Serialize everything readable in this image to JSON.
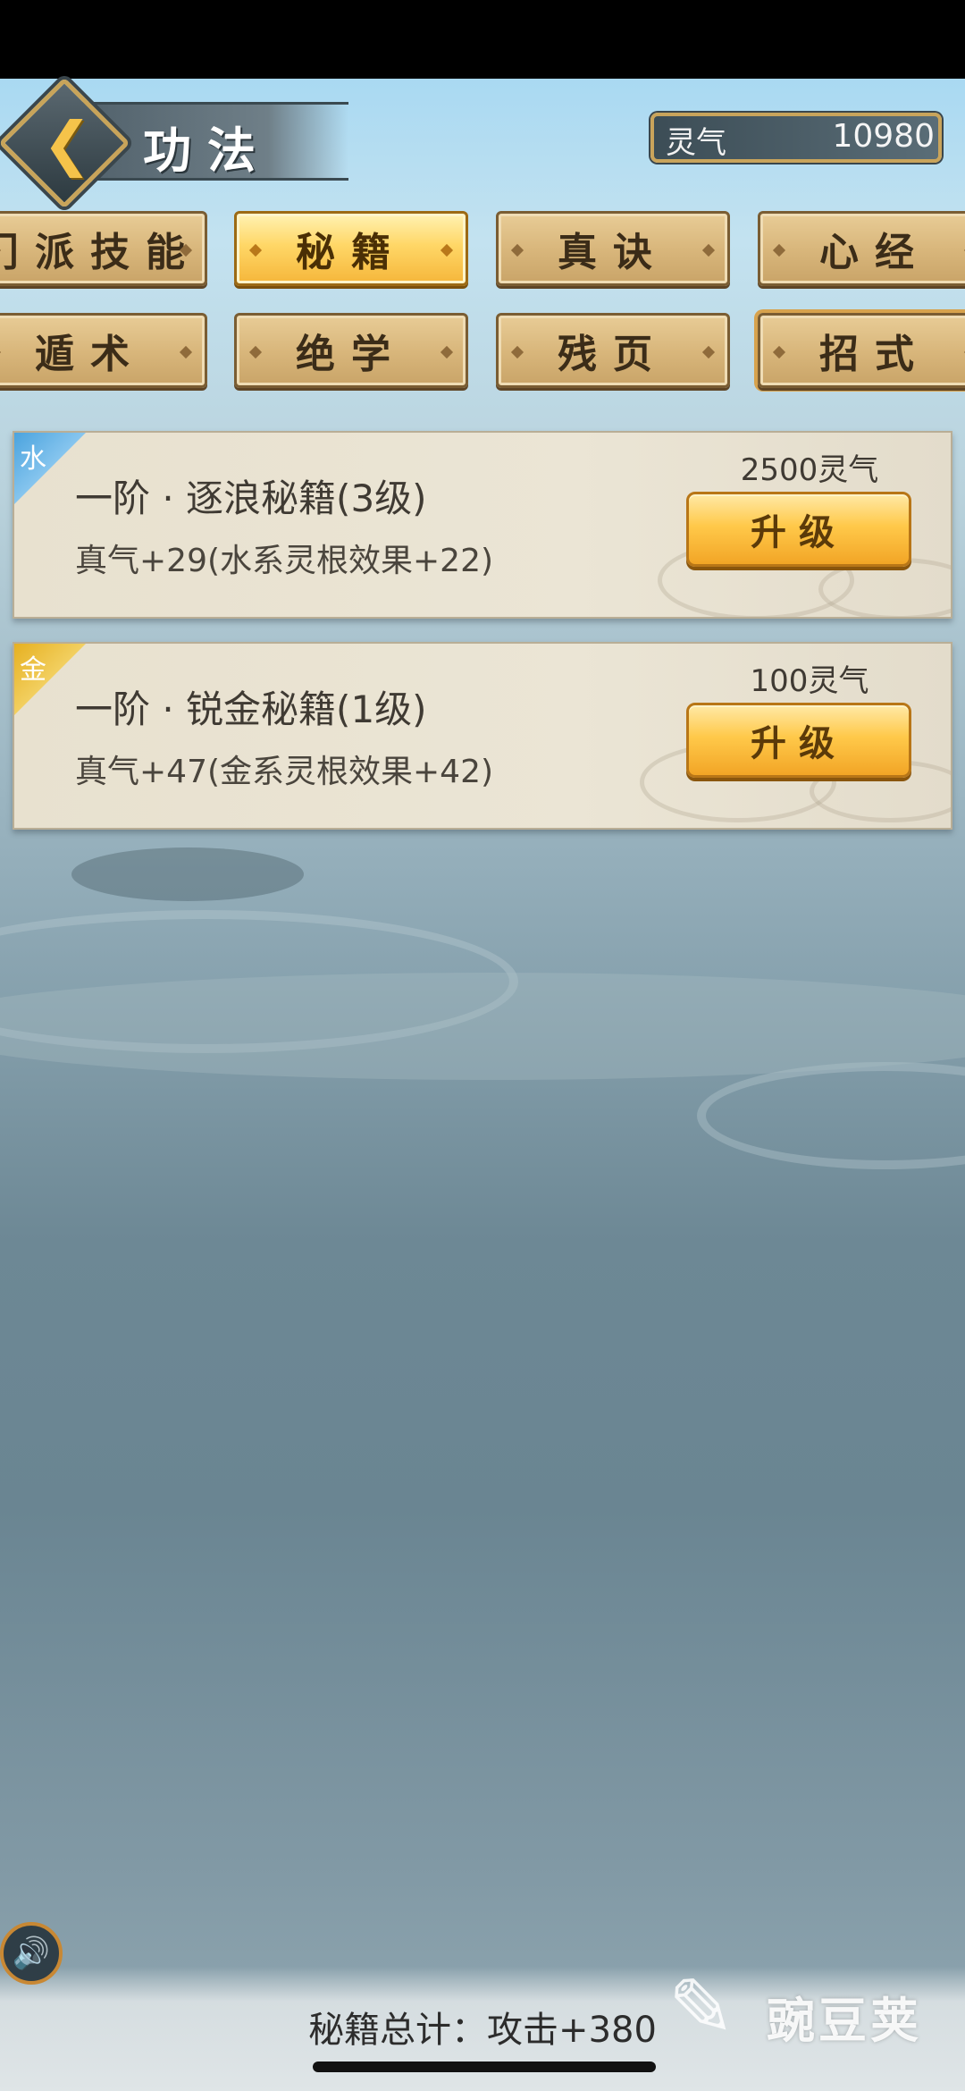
{
  "header": {
    "title": "功法",
    "back_icon": "chevron-left-icon",
    "energy_label": "灵气",
    "energy_value": "10980"
  },
  "tabs": {
    "row1": [
      "门派技能",
      "秘籍",
      "真诀",
      "心经"
    ],
    "row2": [
      "遁术",
      "绝学",
      "残页",
      "招式"
    ],
    "active": "秘籍"
  },
  "cards": [
    {
      "element": "水",
      "element_color": "#4aa3de",
      "title": "一阶 · 逐浪秘籍(3级)",
      "desc": "真气+29(水系灵根效果+22)",
      "cost": "2500灵气",
      "button": "升级"
    },
    {
      "element": "金",
      "element_color": "#e6b020",
      "title": "一阶 · 锐金秘籍(1级)",
      "desc": "真气+47(金系灵根效果+42)",
      "cost": "100灵气",
      "button": "升级"
    }
  ],
  "footer": {
    "total": "秘籍总计：攻击+380",
    "sound_icon": "speaker-icon",
    "watermark": "豌豆荚"
  }
}
